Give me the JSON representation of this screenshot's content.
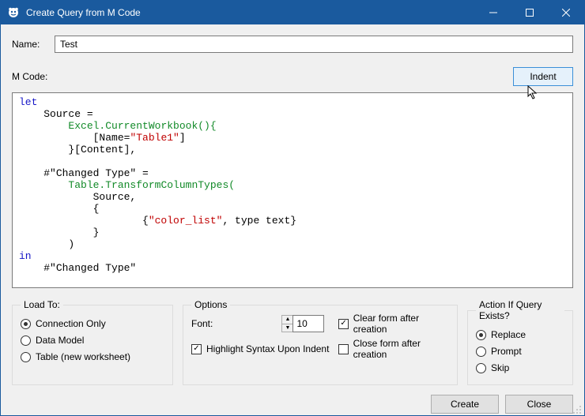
{
  "window": {
    "title": "Create Query from M Code"
  },
  "labels": {
    "name": "Name:",
    "mcode": "M Code:",
    "indent": "Indent"
  },
  "name_input": {
    "value": "Test"
  },
  "code": {
    "lines": [
      {
        "cls": "kw",
        "indent": 0,
        "text": "let"
      },
      {
        "cls": "",
        "indent": 1,
        "text": "Source ="
      },
      {
        "cls": "fn",
        "indent": 2,
        "text": "Excel.CurrentWorkbook(){"
      },
      {
        "cls": "",
        "indent": 3,
        "prefix": "[Name=",
        "str": "\"Table1\"",
        "suffix": "]"
      },
      {
        "cls": "",
        "indent": 2,
        "text": "}[Content],"
      },
      {
        "cls": "",
        "indent": 0,
        "text": ""
      },
      {
        "cls": "",
        "indent": 1,
        "text": "#\"Changed Type\" ="
      },
      {
        "cls": "fn",
        "indent": 2,
        "text": "Table.TransformColumnTypes("
      },
      {
        "cls": "",
        "indent": 3,
        "text": "Source,"
      },
      {
        "cls": "",
        "indent": 3,
        "text": "{"
      },
      {
        "cls": "",
        "indent": 5,
        "prefix": "{",
        "str": "\"color_list\"",
        "suffix": ", type text}"
      },
      {
        "cls": "",
        "indent": 3,
        "text": "}"
      },
      {
        "cls": "",
        "indent": 2,
        "text": ")"
      },
      {
        "cls": "kw",
        "indent": 0,
        "text": "in"
      },
      {
        "cls": "",
        "indent": 1,
        "text": "#\"Changed Type\""
      }
    ]
  },
  "load_to": {
    "legend": "Load To:",
    "options": [
      {
        "label": "Connection Only",
        "selected": true
      },
      {
        "label": "Data Model",
        "selected": false
      },
      {
        "label": "Table (new worksheet)",
        "selected": false
      }
    ]
  },
  "options": {
    "legend": "Options",
    "font_label": "Font:",
    "font_value": "10",
    "highlight": {
      "label": "Highlight Syntax Upon Indent",
      "checked": true
    },
    "clear": {
      "label": "Clear form after creation",
      "checked": true
    },
    "close": {
      "label": "Close form after creation",
      "checked": false
    }
  },
  "action": {
    "legend": "Action If Query Exists?",
    "options": [
      {
        "label": "Replace",
        "selected": true
      },
      {
        "label": "Prompt",
        "selected": false
      },
      {
        "label": "Skip",
        "selected": false
      }
    ]
  },
  "footer": {
    "create": "Create",
    "close": "Close"
  }
}
